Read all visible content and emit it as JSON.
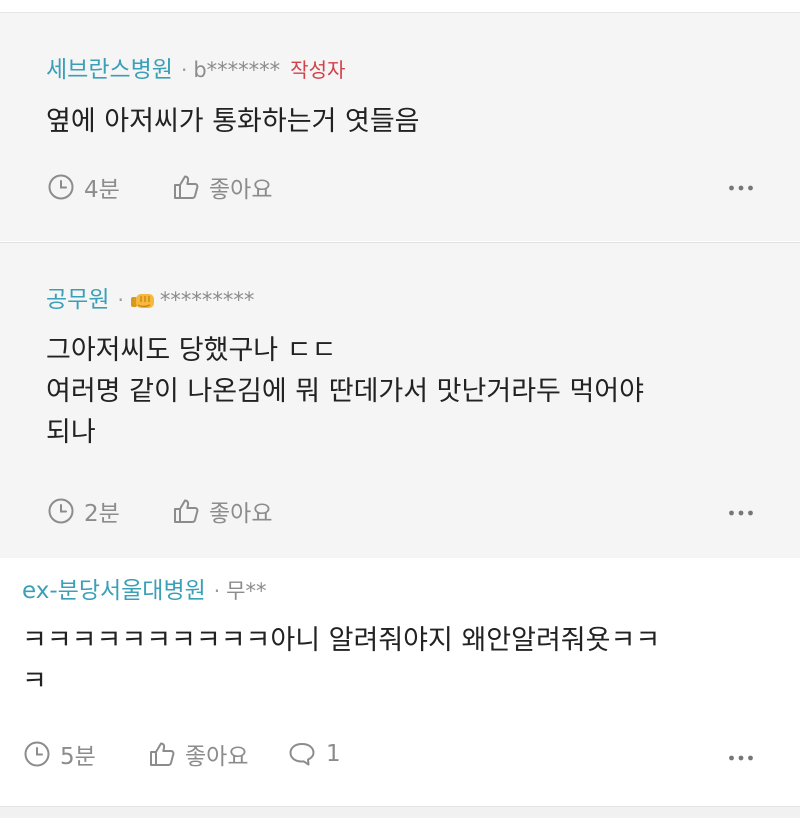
{
  "comments": [
    {
      "org": "세브란스병원",
      "separator": "·",
      "nickname": "b*******",
      "badge": "작성자",
      "lines": [
        "옆에 아저씨가 통화하는거 엿들음"
      ],
      "time": "4분",
      "like_label": "좋아요"
    },
    {
      "org": "공무원",
      "separator": "·",
      "nickname_emoji": "fist-emoji",
      "nickname": "*********",
      "lines": [
        "그아저씨도 당했구나 ㄷㄷ",
        "여러명 같이 나온김에 뭐 딴데가서 맛난거라두 먹어야",
        "되나"
      ],
      "time": "2분",
      "like_label": "좋아요"
    },
    {
      "org": "ex-분당서울대병원",
      "separator": "·",
      "nickname": "무**",
      "lines": [
        "ㅋㅋㅋㅋㅋㅋㅋㅋㅋㅋ아니 알려줘야지 왜안알려줘욧ㅋㅋ",
        "ㅋ"
      ],
      "time": "5분",
      "like_label": "좋아요",
      "reply_count": "1"
    }
  ],
  "icons": {
    "time": "clock-icon",
    "like": "thumbs-up-icon",
    "reply": "speech-bubble-icon",
    "more": "more-dots-icon"
  },
  "colors": {
    "org": "#3aa0b8",
    "badge": "#d2404a",
    "meta_gray": "#8c8c8c",
    "card_bg": "#f5f5f5"
  }
}
